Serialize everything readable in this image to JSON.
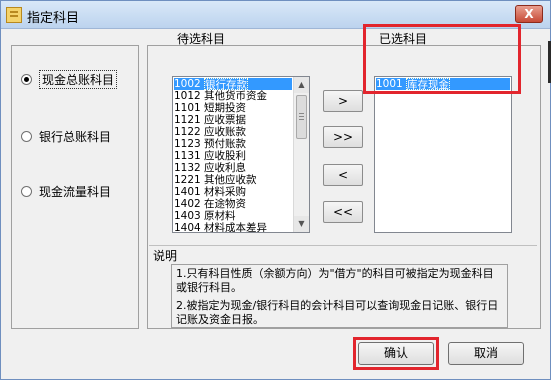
{
  "window": {
    "title": "指定科目",
    "close_glyph": "X"
  },
  "radios": [
    {
      "label": "现金总账科目",
      "checked": true
    },
    {
      "label": "银行总账科目",
      "checked": false
    },
    {
      "label": "现金流量科目",
      "checked": false
    }
  ],
  "candidate": {
    "label": "待选科目",
    "items": [
      {
        "code": "1002",
        "name": "银行存款",
        "selected": true
      },
      {
        "code": "1012",
        "name": "其他货币资金"
      },
      {
        "code": "1101",
        "name": "短期投资"
      },
      {
        "code": "1121",
        "name": "应收票据"
      },
      {
        "code": "1122",
        "name": "应收账款"
      },
      {
        "code": "1123",
        "name": "预付账款"
      },
      {
        "code": "1131",
        "name": "应收股利"
      },
      {
        "code": "1132",
        "name": "应收利息"
      },
      {
        "code": "1221",
        "name": "其他应收款"
      },
      {
        "code": "1401",
        "name": "材料采购"
      },
      {
        "code": "1402",
        "name": "在途物资"
      },
      {
        "code": "1403",
        "name": "原材料"
      },
      {
        "code": "1404",
        "name": "材料成本差异"
      }
    ]
  },
  "selected_list": {
    "label": "已选科目",
    "items": [
      {
        "code": "1001",
        "name": "库存现金",
        "selected": true
      }
    ]
  },
  "move_buttons": {
    "add_one": ">",
    "add_all": ">>",
    "remove_one": "<",
    "remove_all": "<<"
  },
  "notes": {
    "legend": "说明",
    "line1": "1.只有科目性质（余额方向）为\"借方\"的科目可被指定为现金科目或银行科目。",
    "line2": "2.被指定为现金/银行科目的会计科目可以查询现金日记账、银行日记账及资金日报。"
  },
  "buttons": {
    "ok": "确认",
    "cancel": "取消"
  },
  "colors": {
    "highlight": "#e2252d",
    "selection": "#3399ff"
  }
}
